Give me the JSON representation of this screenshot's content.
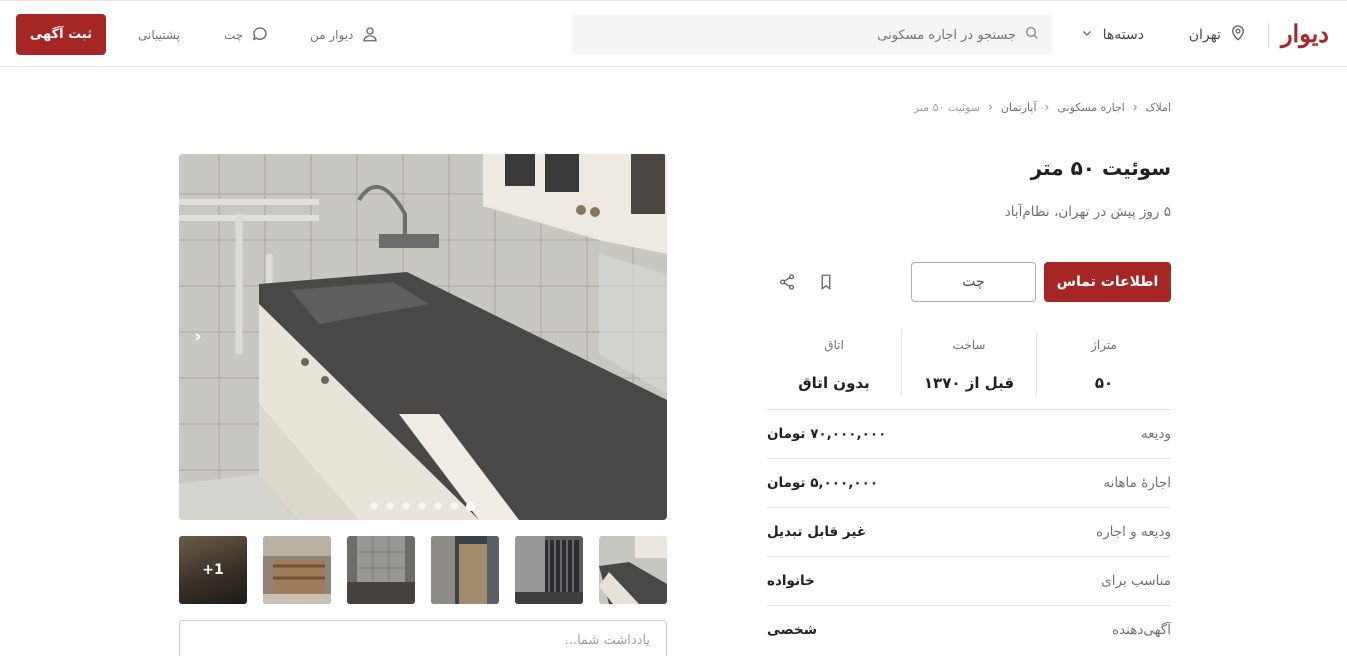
{
  "header": {
    "logo": "دیوار",
    "city": "تهران",
    "categories_label": "دسته‌ها",
    "search_placeholder": "جستجو در اجاره مسکونی",
    "my_divar": "دیوار من",
    "chat": "چت",
    "support": "پشتیبانی",
    "post_ad": "ثبت آگهی"
  },
  "breadcrumb": [
    "املاک",
    "اجاره مسکونی",
    "آپارتمان",
    "سوئیت ۵۰ متر"
  ],
  "listing": {
    "title": "سوئیت ۵۰ متر",
    "subtitle": "۵ روز پیش در تهران، نظام‌آباد",
    "contact_button": "اطلاعات تماس",
    "chat_button": "چت"
  },
  "stats": [
    {
      "label": "متراژ",
      "value": "۵۰"
    },
    {
      "label": "ساخت",
      "value": "قبل از ۱۳۷۰"
    },
    {
      "label": "اتاق",
      "value": "بدون اتاق"
    }
  ],
  "details": [
    {
      "label": "ودیعه",
      "value": "۷۰,۰۰۰,۰۰۰ تومان"
    },
    {
      "label": "اجارهٔ ماهانه",
      "value": "۵,۰۰۰,۰۰۰ تومان"
    },
    {
      "label": "ودیعه و اجاره",
      "value": "غیر قابل تبدیل"
    },
    {
      "label": "مناسب برای",
      "value": "خانواده"
    },
    {
      "label": "آگهی‌دهنده",
      "value": "شخصی"
    }
  ],
  "gallery": {
    "more_count": "+1",
    "total_images": 7,
    "active_index": 0
  },
  "note": {
    "placeholder": "یادداشت شما..."
  },
  "colors": {
    "brand": "#a62626"
  }
}
